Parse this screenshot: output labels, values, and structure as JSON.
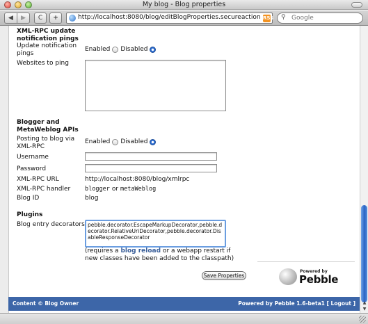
{
  "window": {
    "title": "My blog - Blog properties"
  },
  "toolbar": {
    "back": "◀",
    "forward": "▶",
    "reload": "C",
    "add_tab": "+",
    "url": "http://localhost:8080/blog/editBlogProperties.secureaction",
    "rss": "RSS",
    "search_placeholder": "Google"
  },
  "xmlrpc_pings": {
    "title": "XML-RPC update notification pings",
    "update_label": "Update notification pings",
    "enabled": "Enabled",
    "disabled": "Disabled",
    "selected": "disabled",
    "websites_label": "Websites to ping",
    "websites_value": ""
  },
  "blogger_api": {
    "title": "Blogger and MetaWeblog APIs",
    "posting_label": "Posting to blog via XML-RPC",
    "enabled": "Enabled",
    "disabled": "Disabled",
    "selected": "disabled",
    "username_label": "Username",
    "username_value": "",
    "password_label": "Password",
    "password_value": "",
    "url_label": "XML-RPC URL",
    "url_value": "http://localhost:8080/blog/xmlrpc",
    "handler_label": "XML-RPC handler",
    "handler_a": "blogger",
    "handler_or": "or",
    "handler_b": "metaWeblog",
    "blogid_label": "Blog ID",
    "blogid_value": "blog"
  },
  "plugins": {
    "title": "Plugins",
    "decorators_label": "Blog entry decorators",
    "decorators_value": "pebble.decorator.EscapeMarkupDecorator,pebble.decorator.RelativeUriDecorator,pebble.decorator.DisableResponseDecorator",
    "note_prefix": "(requires a",
    "note_link": "blog reload",
    "note_suffix": "or a webapp restart if new classes have been added to the classpath)"
  },
  "actions": {
    "save": "Save Properties"
  },
  "branding": {
    "powered_by": "Powered by",
    "name": "Pebble"
  },
  "footer": {
    "left": "Content © Blog Owner",
    "right_prefix": "Powered by Pebble 1.6-beta1 [",
    "logout": "Logout",
    "right_suffix": "]"
  },
  "colors": {
    "footer_bg": "#3d66a8",
    "link": "#3a5f99",
    "radio_selected": "#2a6bd1"
  }
}
